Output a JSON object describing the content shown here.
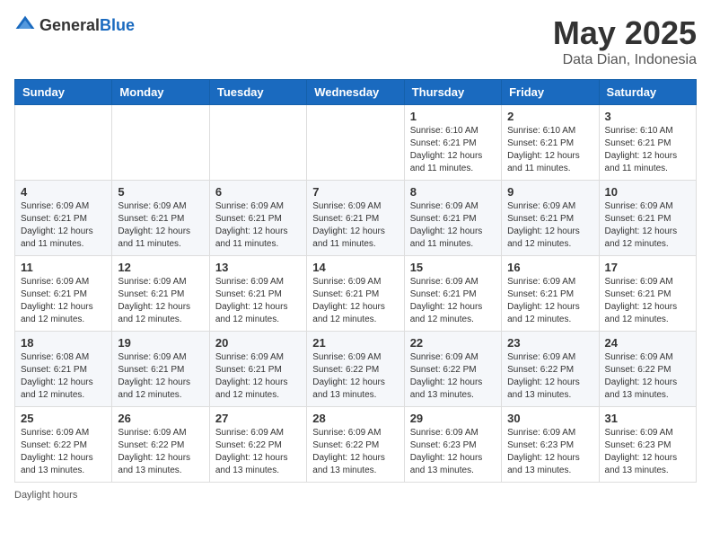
{
  "header": {
    "logo_general": "General",
    "logo_blue": "Blue",
    "month_year": "May 2025",
    "location": "Data Dian, Indonesia"
  },
  "days_of_week": [
    "Sunday",
    "Monday",
    "Tuesday",
    "Wednesday",
    "Thursday",
    "Friday",
    "Saturday"
  ],
  "footer": {
    "daylight_hours": "Daylight hours"
  },
  "weeks": [
    [
      {
        "day": "",
        "info": ""
      },
      {
        "day": "",
        "info": ""
      },
      {
        "day": "",
        "info": ""
      },
      {
        "day": "",
        "info": ""
      },
      {
        "day": "1",
        "info": "Sunrise: 6:10 AM\nSunset: 6:21 PM\nDaylight: 12 hours\nand 11 minutes."
      },
      {
        "day": "2",
        "info": "Sunrise: 6:10 AM\nSunset: 6:21 PM\nDaylight: 12 hours\nand 11 minutes."
      },
      {
        "day": "3",
        "info": "Sunrise: 6:10 AM\nSunset: 6:21 PM\nDaylight: 12 hours\nand 11 minutes."
      }
    ],
    [
      {
        "day": "4",
        "info": "Sunrise: 6:09 AM\nSunset: 6:21 PM\nDaylight: 12 hours\nand 11 minutes."
      },
      {
        "day": "5",
        "info": "Sunrise: 6:09 AM\nSunset: 6:21 PM\nDaylight: 12 hours\nand 11 minutes."
      },
      {
        "day": "6",
        "info": "Sunrise: 6:09 AM\nSunset: 6:21 PM\nDaylight: 12 hours\nand 11 minutes."
      },
      {
        "day": "7",
        "info": "Sunrise: 6:09 AM\nSunset: 6:21 PM\nDaylight: 12 hours\nand 11 minutes."
      },
      {
        "day": "8",
        "info": "Sunrise: 6:09 AM\nSunset: 6:21 PM\nDaylight: 12 hours\nand 11 minutes."
      },
      {
        "day": "9",
        "info": "Sunrise: 6:09 AM\nSunset: 6:21 PM\nDaylight: 12 hours\nand 12 minutes."
      },
      {
        "day": "10",
        "info": "Sunrise: 6:09 AM\nSunset: 6:21 PM\nDaylight: 12 hours\nand 12 minutes."
      }
    ],
    [
      {
        "day": "11",
        "info": "Sunrise: 6:09 AM\nSunset: 6:21 PM\nDaylight: 12 hours\nand 12 minutes."
      },
      {
        "day": "12",
        "info": "Sunrise: 6:09 AM\nSunset: 6:21 PM\nDaylight: 12 hours\nand 12 minutes."
      },
      {
        "day": "13",
        "info": "Sunrise: 6:09 AM\nSunset: 6:21 PM\nDaylight: 12 hours\nand 12 minutes."
      },
      {
        "day": "14",
        "info": "Sunrise: 6:09 AM\nSunset: 6:21 PM\nDaylight: 12 hours\nand 12 minutes."
      },
      {
        "day": "15",
        "info": "Sunrise: 6:09 AM\nSunset: 6:21 PM\nDaylight: 12 hours\nand 12 minutes."
      },
      {
        "day": "16",
        "info": "Sunrise: 6:09 AM\nSunset: 6:21 PM\nDaylight: 12 hours\nand 12 minutes."
      },
      {
        "day": "17",
        "info": "Sunrise: 6:09 AM\nSunset: 6:21 PM\nDaylight: 12 hours\nand 12 minutes."
      }
    ],
    [
      {
        "day": "18",
        "info": "Sunrise: 6:08 AM\nSunset: 6:21 PM\nDaylight: 12 hours\nand 12 minutes."
      },
      {
        "day": "19",
        "info": "Sunrise: 6:09 AM\nSunset: 6:21 PM\nDaylight: 12 hours\nand 12 minutes."
      },
      {
        "day": "20",
        "info": "Sunrise: 6:09 AM\nSunset: 6:21 PM\nDaylight: 12 hours\nand 12 minutes."
      },
      {
        "day": "21",
        "info": "Sunrise: 6:09 AM\nSunset: 6:22 PM\nDaylight: 12 hours\nand 13 minutes."
      },
      {
        "day": "22",
        "info": "Sunrise: 6:09 AM\nSunset: 6:22 PM\nDaylight: 12 hours\nand 13 minutes."
      },
      {
        "day": "23",
        "info": "Sunrise: 6:09 AM\nSunset: 6:22 PM\nDaylight: 12 hours\nand 13 minutes."
      },
      {
        "day": "24",
        "info": "Sunrise: 6:09 AM\nSunset: 6:22 PM\nDaylight: 12 hours\nand 13 minutes."
      }
    ],
    [
      {
        "day": "25",
        "info": "Sunrise: 6:09 AM\nSunset: 6:22 PM\nDaylight: 12 hours\nand 13 minutes."
      },
      {
        "day": "26",
        "info": "Sunrise: 6:09 AM\nSunset: 6:22 PM\nDaylight: 12 hours\nand 13 minutes."
      },
      {
        "day": "27",
        "info": "Sunrise: 6:09 AM\nSunset: 6:22 PM\nDaylight: 12 hours\nand 13 minutes."
      },
      {
        "day": "28",
        "info": "Sunrise: 6:09 AM\nSunset: 6:22 PM\nDaylight: 12 hours\nand 13 minutes."
      },
      {
        "day": "29",
        "info": "Sunrise: 6:09 AM\nSunset: 6:23 PM\nDaylight: 12 hours\nand 13 minutes."
      },
      {
        "day": "30",
        "info": "Sunrise: 6:09 AM\nSunset: 6:23 PM\nDaylight: 12 hours\nand 13 minutes."
      },
      {
        "day": "31",
        "info": "Sunrise: 6:09 AM\nSunset: 6:23 PM\nDaylight: 12 hours\nand 13 minutes."
      }
    ]
  ]
}
